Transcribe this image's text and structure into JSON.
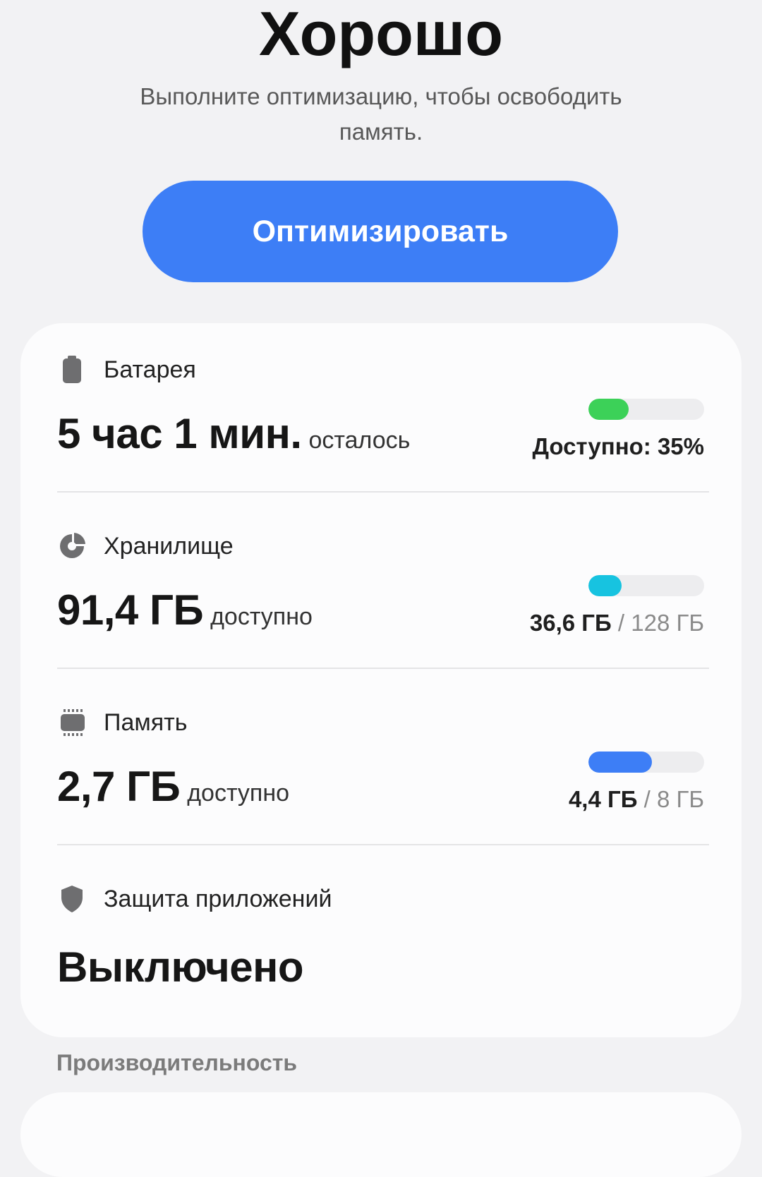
{
  "status": {
    "title": "Хорошо",
    "description": "Выполните оптимизацию, чтобы освободить память."
  },
  "optimize_button": {
    "label": "Оптимизировать"
  },
  "battery": {
    "label": "Батарея",
    "value": "5 час 1 мин.",
    "suffix": "осталось",
    "available_text": "Доступно: 35%",
    "level_fraction": 0.35,
    "color": "#3cd158",
    "icon": "battery-icon"
  },
  "storage": {
    "label": "Хранилище",
    "value": "91,4 ГБ",
    "suffix": "доступно",
    "used": "36,6 ГБ",
    "separator": "/",
    "total": "128 ГБ",
    "used_fraction": 0.286,
    "color": "#17c3e0",
    "icon": "pie-chart-icon"
  },
  "memory": {
    "label": "Память",
    "value": "2,7 ГБ",
    "suffix": "доступно",
    "used": "4,4 ГБ",
    "separator": "/",
    "total": "8 ГБ",
    "used_fraction": 0.55,
    "color": "#3d7ef6",
    "icon": "memory-chip-icon"
  },
  "app_protection": {
    "label": "Защита приложений",
    "value": "Выключено",
    "icon": "shield-icon"
  },
  "performance": {
    "label": "Производительность"
  },
  "colors": {
    "accent": "#3d7ef6",
    "background": "#f2f2f4",
    "card": "#fcfcfd",
    "icon_gray": "#6e6e70"
  }
}
